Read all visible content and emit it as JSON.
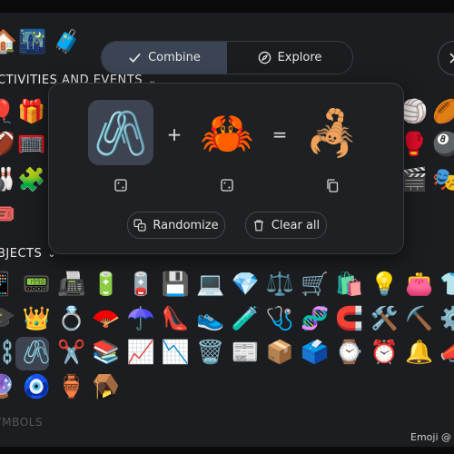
{
  "mode_toggle": {
    "combine_label": "Combine",
    "explore_label": "Explore"
  },
  "sections": {
    "activities_label": "CTIVITIES AND EVENTS",
    "objects_label": "BJECTS",
    "next_label_faded": "SYMBOLS"
  },
  "combine": {
    "first_emoji": "🖇️",
    "second_emoji": "🦀",
    "result_emoji": "🦂",
    "plus_symbol": "+",
    "equals_symbol": "=",
    "randomize_label": "Randomize",
    "clear_label": "Clear all"
  },
  "footer": {
    "credit": "Emoji @ G"
  },
  "grid": {
    "top_row": [
      "🏠",
      "🌃",
      "🧳"
    ],
    "activities_left": [
      "🎈",
      "🎁",
      "🏈",
      "🥅",
      "🎳",
      "🧩",
      "🎟️"
    ],
    "activities_right": [
      "🏐",
      "🏉",
      "🥊",
      "🎱",
      "🎬",
      "🎭"
    ],
    "objects_row1": [
      "📱",
      "📟",
      "📠",
      "🔋",
      "🪫",
      "💾",
      "💻",
      "💎",
      "⚖️",
      "🛒",
      "🛍️",
      "💡",
      "👛",
      "👕"
    ],
    "objects_row2": [
      "🎓",
      "👑",
      "💍",
      "🪭",
      "☂️",
      "👠",
      "👟",
      "🧪",
      "🩺",
      "🧬",
      "🧲",
      "🛠️",
      "⛏️",
      "⚙️"
    ],
    "objects_row3": [
      "⛓️",
      "🖇️",
      "✂️",
      "📚",
      "📈",
      "📉",
      "🗑️",
      "📰",
      "📦",
      "🗳️",
      "⌚",
      "⏰",
      "🔔",
      "📣"
    ],
    "objects_row4": [
      "🔮",
      "🧿",
      "🏺",
      "🪤"
    ]
  }
}
